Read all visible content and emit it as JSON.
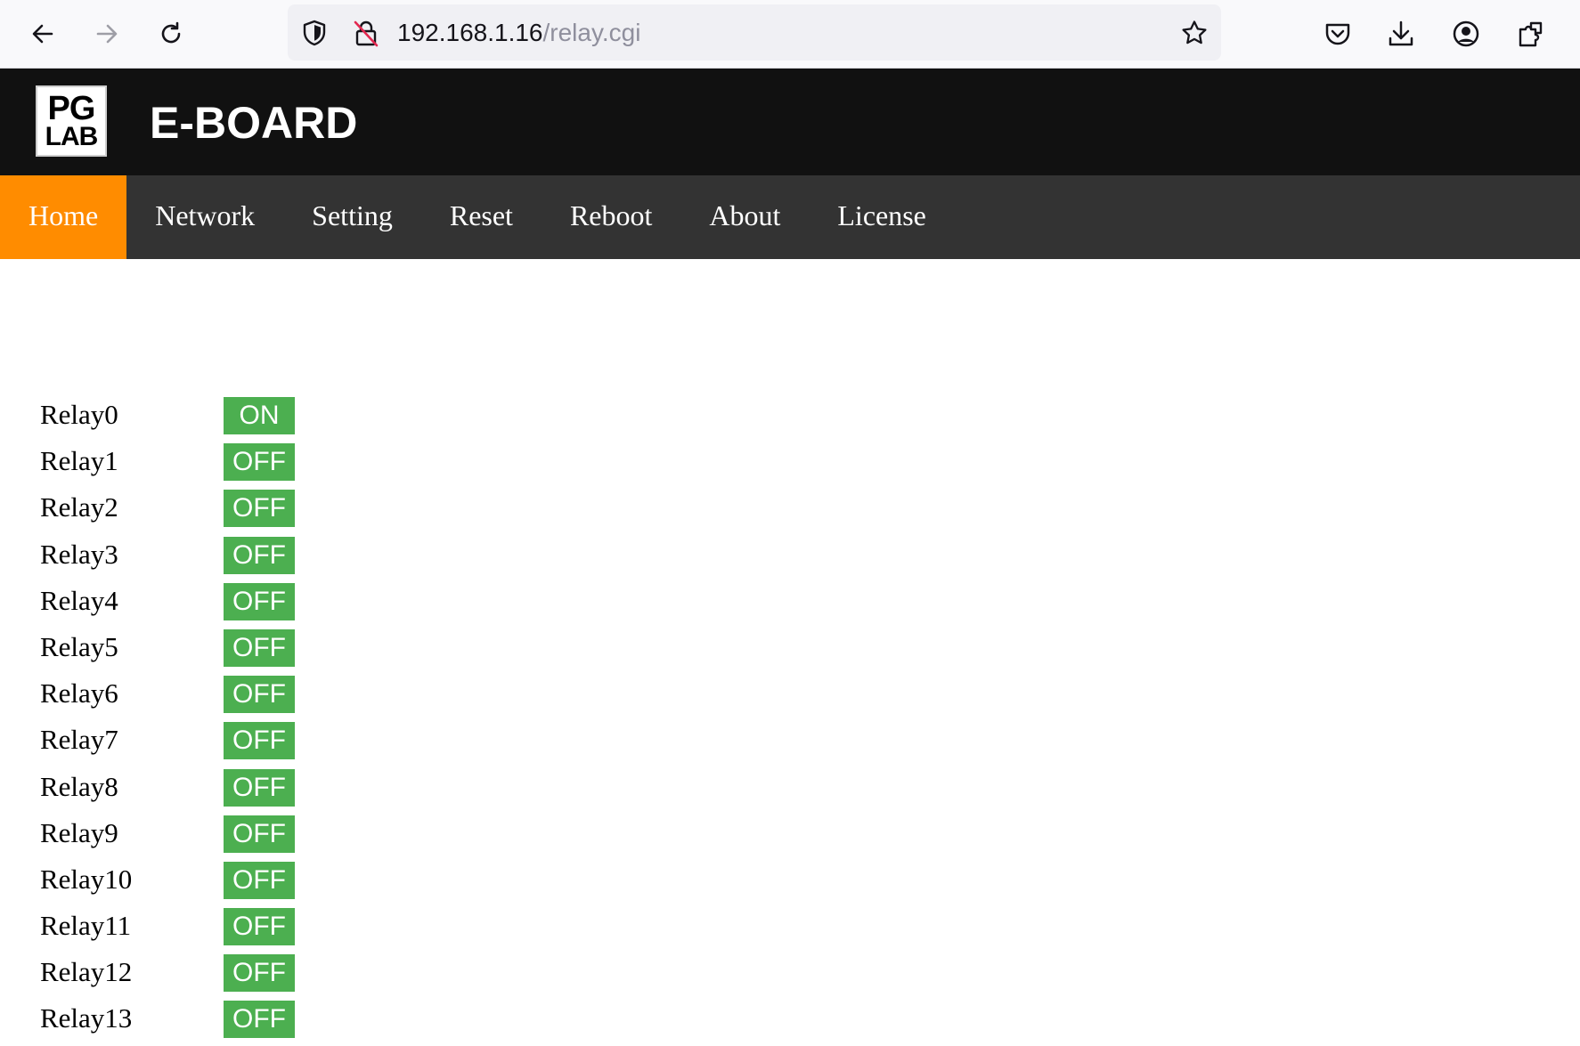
{
  "browser": {
    "url_host": "192.168.1.16",
    "url_path": "/relay.cgi",
    "icons": {
      "back": "back-arrow-icon",
      "forward": "forward-arrow-icon",
      "reload": "reload-icon",
      "shield": "tracking-protection-shield-icon",
      "insecure": "insecure-lock-icon",
      "bookmark": "bookmark-star-icon",
      "pocket": "pocket-icon",
      "download": "download-icon",
      "account": "account-icon",
      "extensions": "extensions-icon"
    }
  },
  "header": {
    "logo_top": "PG",
    "logo_bottom": "LAB",
    "title": "E-BOARD"
  },
  "nav": {
    "items": [
      {
        "label": "Home",
        "active": true
      },
      {
        "label": "Network",
        "active": false
      },
      {
        "label": "Setting",
        "active": false
      },
      {
        "label": "Reset",
        "active": false
      },
      {
        "label": "Reboot",
        "active": false
      },
      {
        "label": "About",
        "active": false
      },
      {
        "label": "License",
        "active": false
      }
    ]
  },
  "relays": [
    {
      "label": "Relay0",
      "state": "ON"
    },
    {
      "label": "Relay1",
      "state": "OFF"
    },
    {
      "label": "Relay2",
      "state": "OFF"
    },
    {
      "label": "Relay3",
      "state": "OFF"
    },
    {
      "label": "Relay4",
      "state": "OFF"
    },
    {
      "label": "Relay5",
      "state": "OFF"
    },
    {
      "label": "Relay6",
      "state": "OFF"
    },
    {
      "label": "Relay7",
      "state": "OFF"
    },
    {
      "label": "Relay8",
      "state": "OFF"
    },
    {
      "label": "Relay9",
      "state": "OFF"
    },
    {
      "label": "Relay10",
      "state": "OFF"
    },
    {
      "label": "Relay11",
      "state": "OFF"
    },
    {
      "label": "Relay12",
      "state": "OFF"
    },
    {
      "label": "Relay13",
      "state": "OFF"
    }
  ],
  "colors": {
    "header_bg": "#111111",
    "nav_bg": "#333333",
    "nav_active": "#ff8c00",
    "relay_button": "#4caf50"
  }
}
